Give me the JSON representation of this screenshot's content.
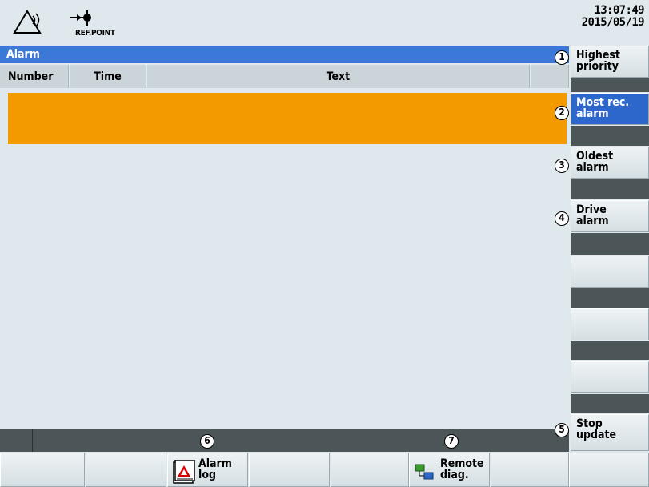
{
  "header": {
    "refpoint_label": "REF.POINT",
    "time": "13:07:49",
    "date": "2015/05/19"
  },
  "alarm_window": {
    "title": "Alarm",
    "columns": [
      "Number",
      "Time",
      "Text"
    ],
    "selected_row_color": "#f39a00",
    "title_bar_color": "#3b78d8"
  },
  "vertical_softkeys": [
    {
      "label": "Highest\npriority",
      "callout": "1"
    },
    {
      "label": "Most rec.\nalarm",
      "callout": "2",
      "active": true
    },
    {
      "label": "Oldest\nalarm",
      "callout": "3"
    },
    {
      "label": "Drive\nalarm",
      "callout": "4"
    },
    {
      "label": "Stop\nupdate",
      "callout": "5"
    }
  ],
  "horizontal_softkeys": {
    "alarm_log": "Alarm\nlog",
    "remote_diag": "Remote\ndiag."
  },
  "callouts": {
    "alarm_log": "6",
    "remote_diag": "7"
  },
  "icons": {
    "warning": "warning-triangle-icon",
    "refpoint": "reference-point-icon",
    "alarm_log": "alarm-log-icon",
    "remote_diag": "network-computers-icon"
  }
}
